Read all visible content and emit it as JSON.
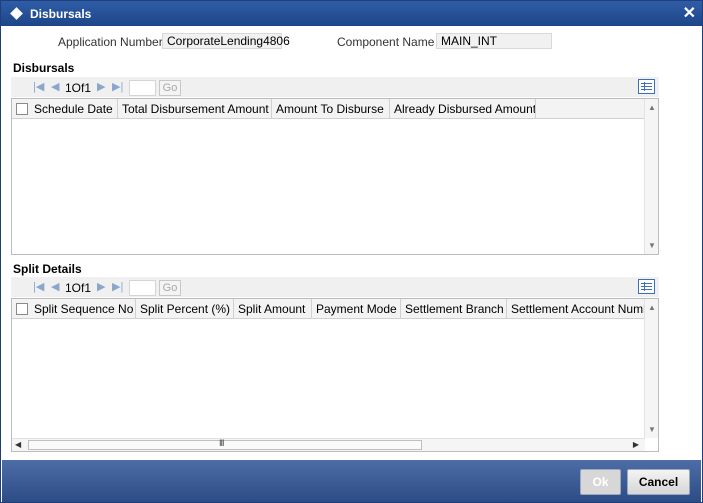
{
  "window": {
    "title": "Disbursals",
    "close_glyph": "✕"
  },
  "header_fields": {
    "application_number_label": "Application Number",
    "application_number_value": "CorporateLending4806",
    "component_name_label": "Component Name",
    "component_name_value": "MAIN_INT"
  },
  "disbursals": {
    "section_title": "Disbursals",
    "pager": {
      "first_glyph": "|◀",
      "prev_glyph": "◀",
      "page_text": "1Of1",
      "next_glyph": "▶",
      "last_glyph": "▶|",
      "go_label": "Go"
    },
    "columns": [
      "Schedule Date",
      "Total Disbursement Amount",
      "Amount To Disburse",
      "Already Disbursed Amount"
    ]
  },
  "split_details": {
    "section_title": "Split Details",
    "pager": {
      "first_glyph": "|◀",
      "prev_glyph": "◀",
      "page_text": "1Of1",
      "next_glyph": "▶",
      "last_glyph": "▶|",
      "go_label": "Go"
    },
    "columns": [
      "Split Sequence No",
      "Split Percent (%)",
      "Split Amount",
      "Payment Mode",
      "Settlement Branch",
      "Settlement Account Numbe"
    ],
    "hscroll_grip": "III"
  },
  "footer": {
    "ok_label": "Ok",
    "cancel_label": "Cancel"
  },
  "icons": {
    "grid_settings": "grid-settings-icon",
    "scroll_up": "▲",
    "scroll_down": "▼",
    "scroll_left": "◀",
    "scroll_right": "▶"
  },
  "colors": {
    "title_bar": "#2a539b",
    "footer": "#3d5e98"
  }
}
